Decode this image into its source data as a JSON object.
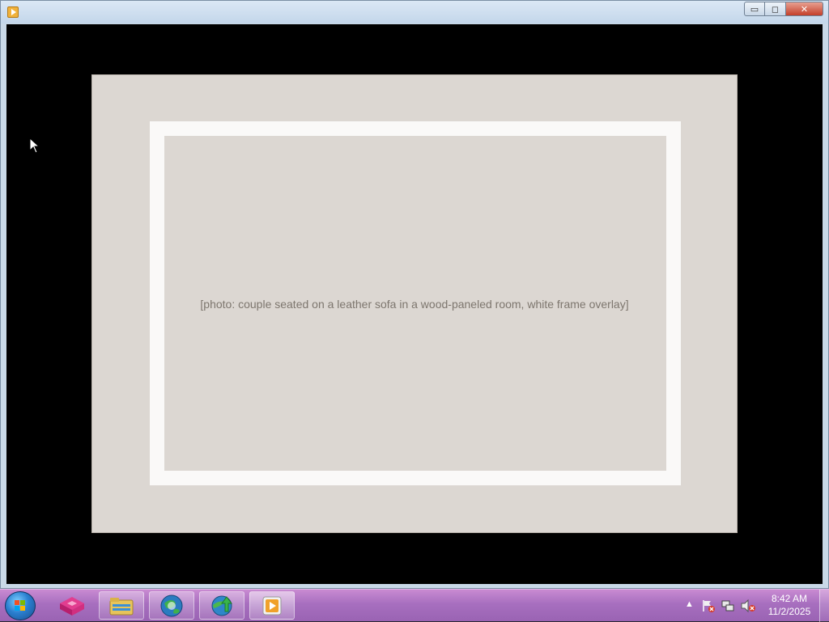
{
  "window": {
    "title": "",
    "buttons": {
      "minimize": "▭",
      "maximize": "◻",
      "close": "✕"
    }
  },
  "slideshow": {
    "photo_label": "[photo: couple seated on a leather sofa in a wood-paneled room, white frame overlay]"
  },
  "taskbar": {
    "pinned": [
      {
        "icon": "pink-cube-app-icon"
      },
      {
        "icon": "file-explorer-icon"
      },
      {
        "icon": "globe-browser-icon"
      },
      {
        "icon": "download-manager-icon"
      },
      {
        "icon": "media-player-icon",
        "active": true
      }
    ],
    "tray": {
      "show_hidden": "▲",
      "time": "8:42 AM",
      "date": "11/2/2025"
    }
  }
}
